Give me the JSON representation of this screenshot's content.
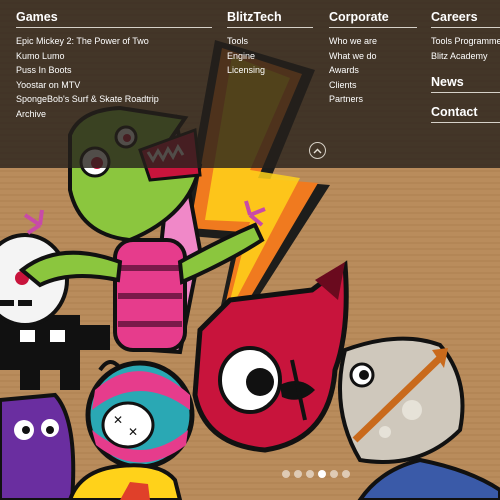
{
  "menu": {
    "games": {
      "title": "Games",
      "links": [
        "Epic Mickey 2: The Power of Two",
        "Kumo Lumo",
        "Puss In Boots",
        "Yoostar on MTV",
        "SpongeBob's Surf & Skate Roadtrip",
        "Archive"
      ]
    },
    "blitztech": {
      "title": "BlitzTech",
      "links": [
        "Tools",
        "Engine",
        "Licensing"
      ]
    },
    "corporate": {
      "title": "Corporate",
      "links": [
        "Who we are",
        "What we do",
        "Awards",
        "Clients",
        "Partners"
      ]
    },
    "careers": {
      "title": "Careers",
      "links": [
        "Tools Programme",
        "Blitz Academy"
      ]
    },
    "news": {
      "title": "News"
    },
    "contact": {
      "title": "Contact"
    }
  },
  "icons": {
    "collapse": "chevron-up-icon"
  },
  "carousel": {
    "slide_count": 6,
    "active_index": 3
  },
  "colors": {
    "menu_background": "#26211b",
    "cardboard": "#b98c5c",
    "dino_green": "#8bc63e",
    "bolt_orange": "#f07a1f",
    "bolt_yellow": "#ffd21a",
    "devil_red": "#c8143c",
    "ball_teal": "#2aa8b4"
  }
}
